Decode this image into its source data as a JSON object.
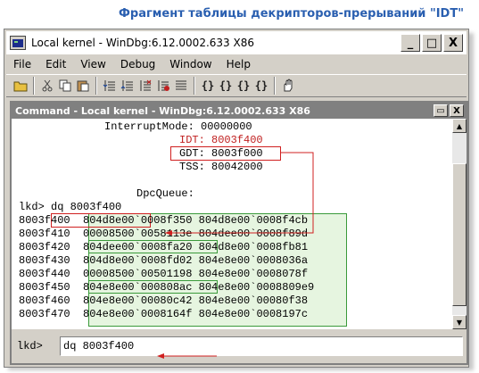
{
  "caption": "Фрагмент таблицы декрипторов-прерываний \"IDT\"",
  "window": {
    "title": "Local kernel - WinDbg:6.12.0002.633 X86",
    "minimize": "_",
    "maximize": "□",
    "close": "X"
  },
  "menu": [
    "File",
    "Edit",
    "View",
    "Debug",
    "Window",
    "Help"
  ],
  "toolbar": {
    "icons": [
      "open-folder-icon",
      "cut-icon",
      "copy-icon",
      "paste-icon",
      "step-into-icon",
      "step-over-icon",
      "break-icon",
      "stop-icon",
      "source-mode-icon",
      "brace-icon-1",
      "brace-icon-2",
      "brace-icon-3",
      "brace-icon-4",
      "hand-icon"
    ]
  },
  "command_window": {
    "title": "Command - Local kernel - WinDbg:6.12.0002.633 X86",
    "btn_restore": "▭",
    "btn_close": "X",
    "lines": [
      {
        "text": "InterruptMode: 00000000"
      },
      {
        "text": "IDT: 8003f400"
      },
      {
        "text": "GDT: 8003f000"
      },
      {
        "text": "TSS: 80042000"
      },
      {
        "text": ""
      },
      {
        "text": "DpcQueue:"
      },
      {
        "text": "lkd> dq 8003f400"
      },
      {
        "text": "8003f400  804d8e00`0008f350 804d8e00`0008f4cb"
      },
      {
        "text": "8003f410  00008500`0058113e 804dee00`0008f89d"
      },
      {
        "text": "8003f420  804dee00`0008fa20 804d8e00`0008fb81"
      },
      {
        "text": "8003f430  804d8e00`0008fd02 804e8e00`0008036a"
      },
      {
        "text": "8003f440  00008500`00501198 804e8e00`0008078f"
      },
      {
        "text": "8003f450  804e8e00`000808ac 804e8e00`0008809e9"
      },
      {
        "text": "8003f460  804e8e00`00080c42 804e8e00`00080f38"
      },
      {
        "text": "8003f470  804e8e00`0008164f 804e8e00`0008197c"
      }
    ],
    "prompt": "lkd>",
    "input_value": "dq 8003f400"
  },
  "annotations": {
    "highlight_color": "#d02020",
    "table_color": "#3a9a3a"
  }
}
